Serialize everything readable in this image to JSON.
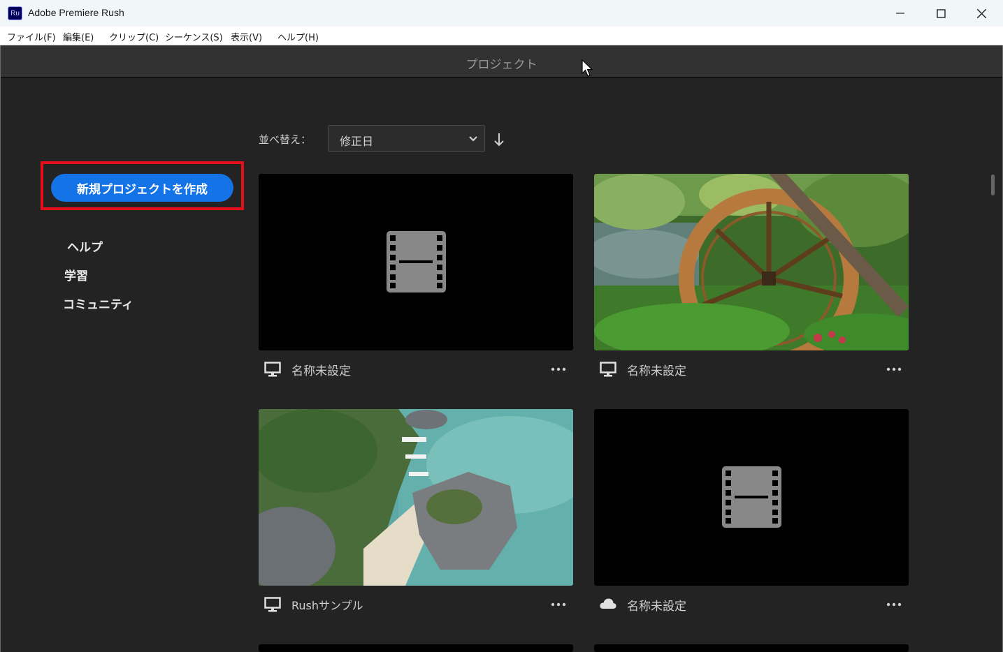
{
  "window": {
    "app_icon_text": "Ru",
    "title": "Adobe Premiere Rush"
  },
  "menu": [
    "ファイル(F)",
    "編集(E)",
    "クリップ(C)",
    "シーケンス(S)",
    "表示(V)",
    "ヘルプ(H)"
  ],
  "header": {
    "title": "プロジェクト"
  },
  "sidebar": {
    "new_project_label": "新規プロジェクトを作成",
    "links": [
      "ヘルプ",
      "学習",
      "コミュニティ"
    ]
  },
  "sort": {
    "label": "並べ替え：",
    "selected": "修正日"
  },
  "projects": [
    {
      "name": "名称未設定",
      "location": "local",
      "thumbnail": "placeholder-film"
    },
    {
      "name": "名称未設定",
      "location": "local",
      "thumbnail": "waterwheel-photo"
    },
    {
      "name": "Rushサンプル",
      "location": "local",
      "thumbnail": "island-aerial-photo"
    },
    {
      "name": "名称未設定",
      "location": "cloud",
      "thumbnail": "placeholder-film"
    }
  ],
  "colors": {
    "accent": "#1473e6",
    "highlight_box": "#e3101a",
    "background": "#232323"
  }
}
